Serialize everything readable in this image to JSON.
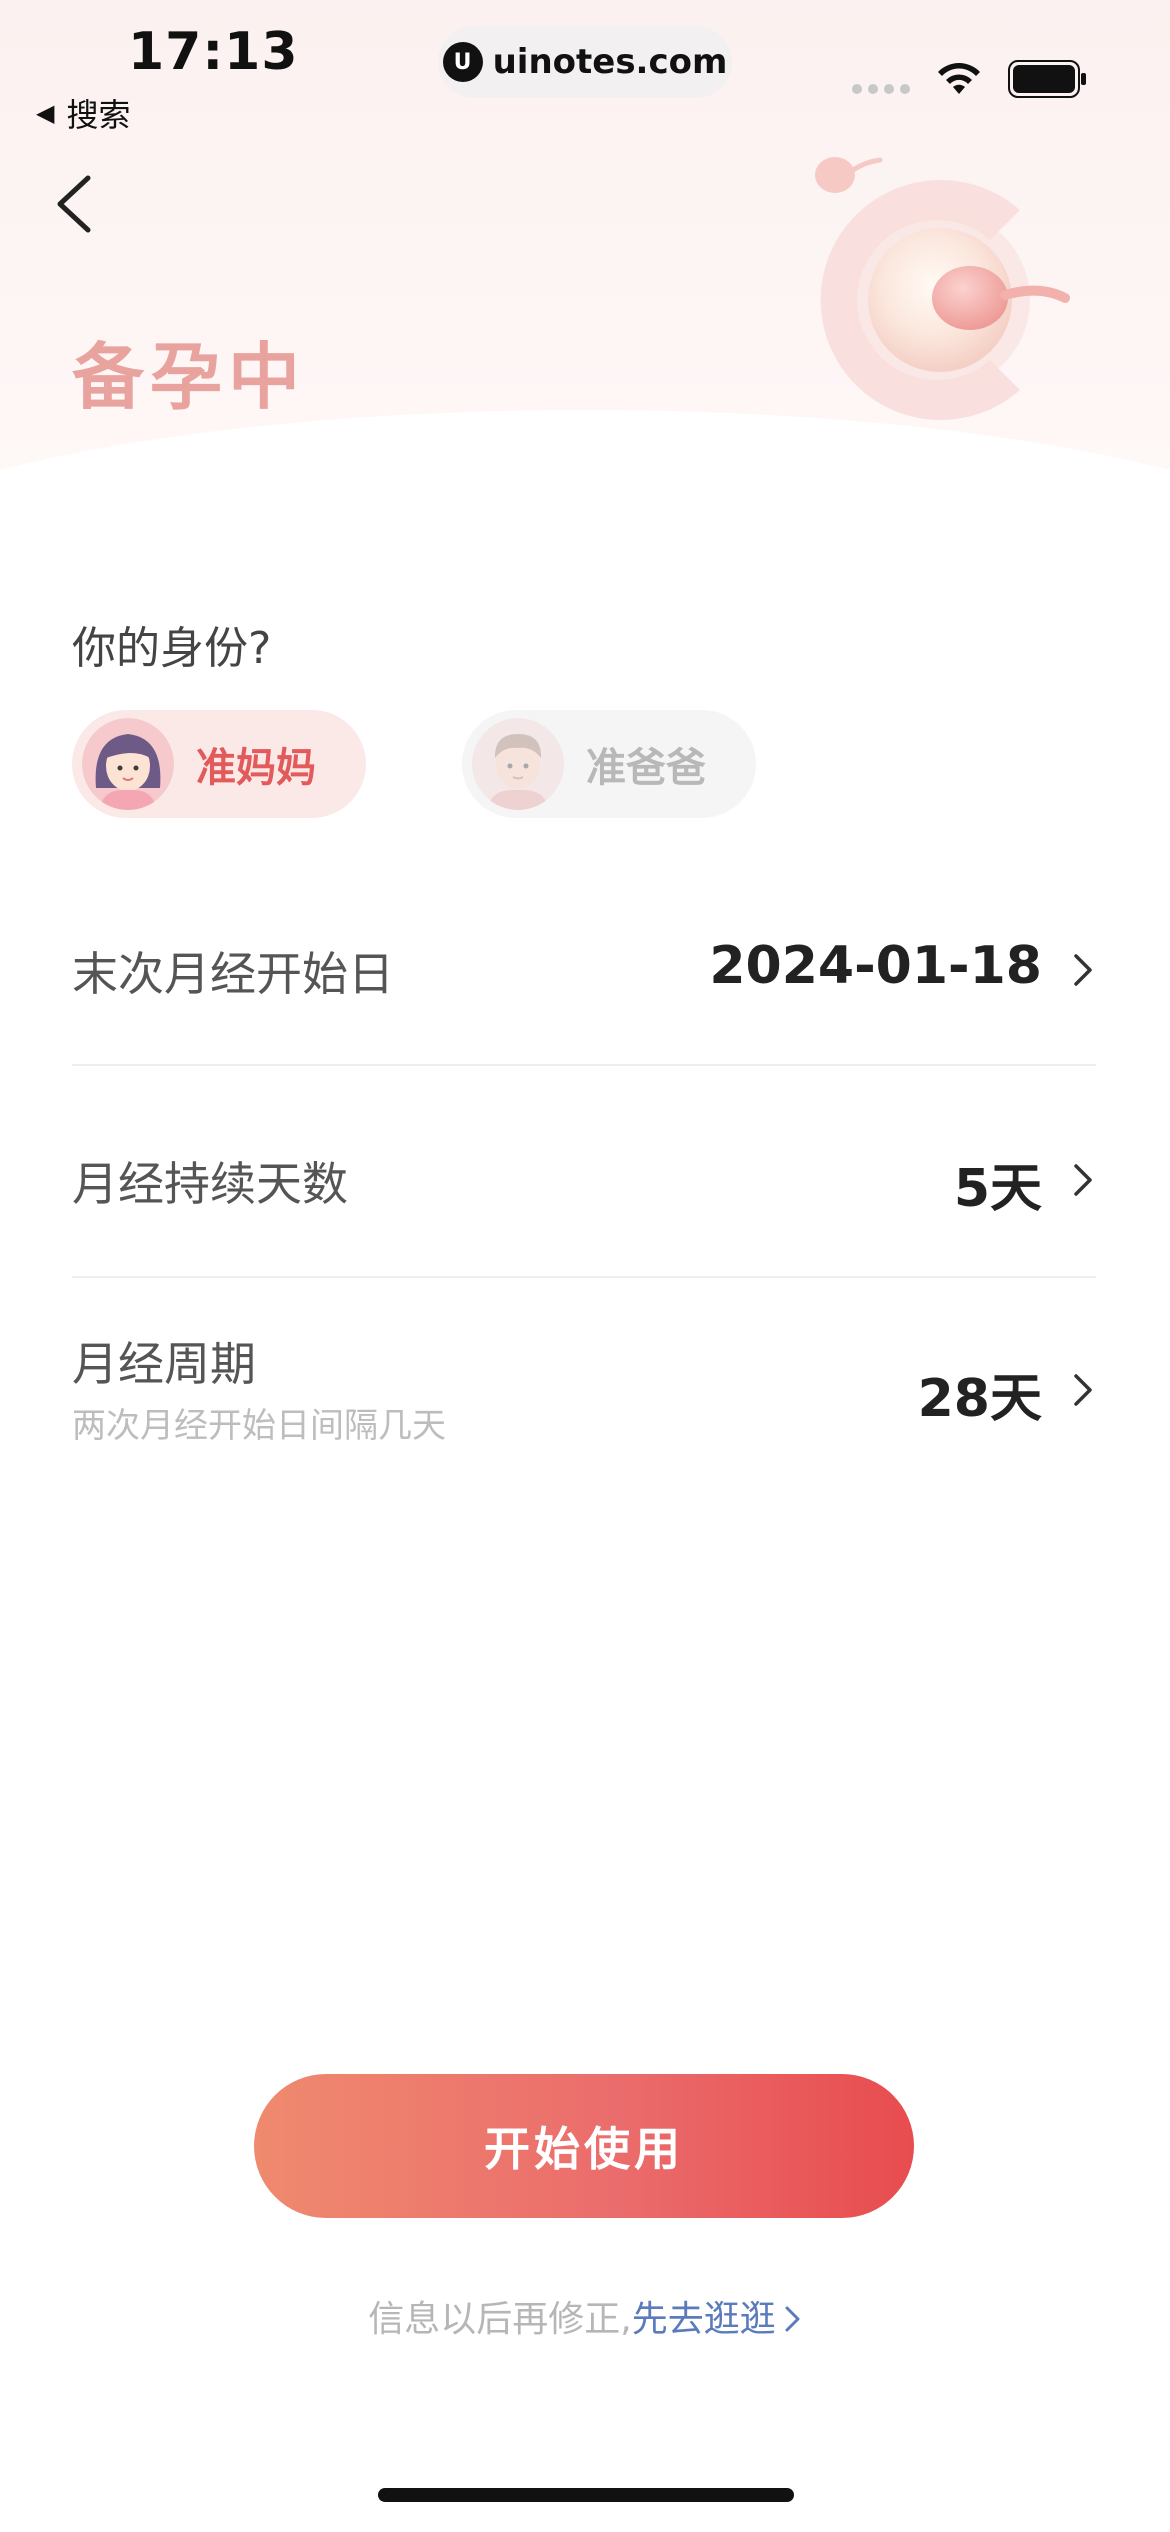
{
  "status_bar": {
    "time": "17:13",
    "back_app": "搜索",
    "url": "uinotes.com",
    "url_logo": "U"
  },
  "header": {
    "title": "备孕中"
  },
  "identity": {
    "question": "你的身份?",
    "options": [
      {
        "label": "准妈妈",
        "selected": true,
        "icon": "mom-avatar-icon"
      },
      {
        "label": "准爸爸",
        "selected": false,
        "icon": "dad-avatar-icon"
      }
    ]
  },
  "settings": {
    "last_period": {
      "label": "末次月经开始日",
      "value": "2024-01-18"
    },
    "period_length": {
      "label": "月经持续天数",
      "value": "5天"
    },
    "cycle_length": {
      "label": "月经周期",
      "sub": "两次月经开始日间隔几天",
      "value": "28天"
    }
  },
  "actions": {
    "start_label": "开始使用",
    "later_prefix": "信息以后再修正,",
    "later_link": "先去逛逛"
  },
  "colors": {
    "accent": "#e84c4f",
    "title_pink": "#e9a39f",
    "link_blue": "#5b7bbd"
  }
}
